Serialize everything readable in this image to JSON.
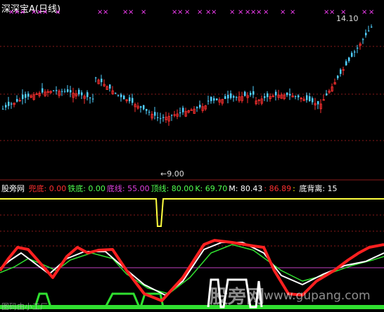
{
  "header": {
    "title": "深深宝A",
    "period": "(日线)"
  },
  "price_labels": {
    "high": "14.10",
    "low": "9.00"
  },
  "indicator": {
    "name": "股旁网",
    "items": [
      {
        "label": "兜底:",
        "value": "0.00",
        "color": "#ff3030"
      },
      {
        "label": "铁底:",
        "value": "0.00",
        "color": "#50ff50"
      },
      {
        "label": "底线:",
        "value": "55.00",
        "color": "#e040e0"
      },
      {
        "label": "顶线:",
        "value": "80.00",
        "color": "#50ff50"
      },
      {
        "label": "K:",
        "value": "69.70",
        "color": "#50ff50"
      },
      {
        "label": "M:",
        "value": "80.43",
        "color": "#ffffff"
      },
      {
        "label": ":",
        "value": "86.89",
        "color": "#ff3030"
      },
      {
        "label": ":",
        "value": "",
        "color": "#ffff00"
      },
      {
        "label": "底背离:",
        "value": "15",
        "color": "#ffffff"
      }
    ]
  },
  "watermark": {
    "text": "股旁网",
    "url": "www.gupang.com",
    "corner": "图码由小工厂"
  },
  "colors": {
    "up": "#ff3030",
    "down": "#50d0ff",
    "signal": "#ff40ff",
    "panel_border": "#ffff00"
  }
}
